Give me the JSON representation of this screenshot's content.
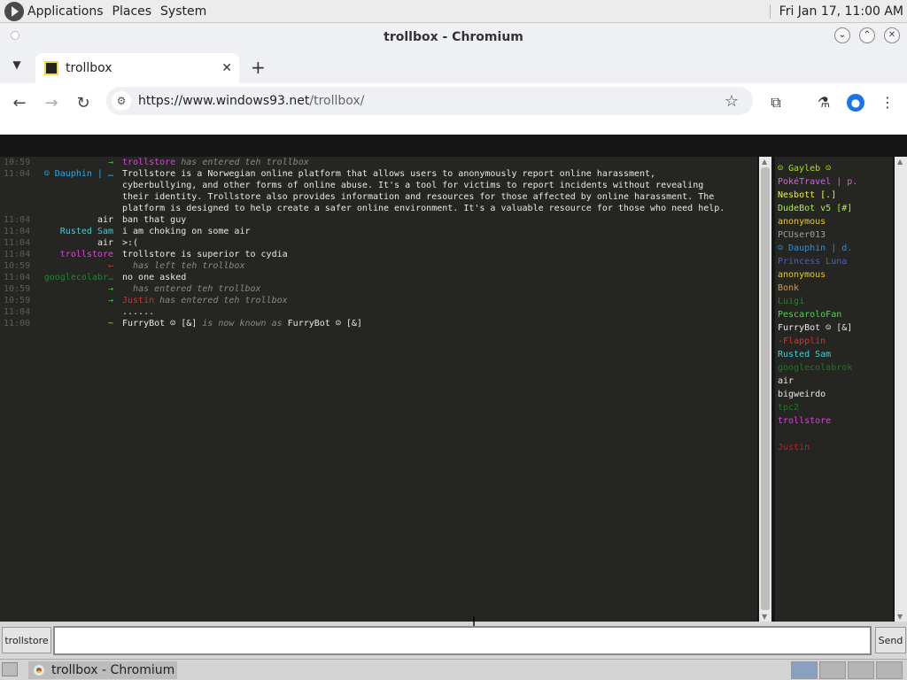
{
  "top_panel": {
    "menus": [
      "Applications",
      "Places",
      "System"
    ],
    "clock": "Fri Jan 17, 11:00 AM"
  },
  "window": {
    "title": "trollbox - Chromium",
    "tab_title": "trollbox",
    "url_host": "https://www.windows93.net",
    "url_path": "/trollbox/"
  },
  "chat": {
    "messages": [
      {
        "time": "10:59",
        "nick": "→",
        "nick_color": "#2ecc40",
        "body": "",
        "pre": "trollstore",
        "pre_color": "#e040e0",
        "sys": " has entered teh trollbox"
      },
      {
        "time": "11:04",
        "nick": "☺ Dauphin | …",
        "nick_color": "#2ea8e8",
        "body": "Trollstore is a Norwegian online platform that allows users to anonymously report online harassment, cyberbullying, and other forms of online abuse. It's a tool for victims to report incidents without revealing their identity. Trollstore also provides information and resources for those affected by online harassment. The platform is designed to help create a safer online environment. It's a valuable resource for those who need help."
      },
      {
        "time": "11:04",
        "nick": "air",
        "nick_color": "#e8e8e8",
        "body": "ban that guy"
      },
      {
        "time": "11:04",
        "nick": "Rusted Sam",
        "nick_color": "#40d0d8",
        "body": "i am choking on some air"
      },
      {
        "time": "11:04",
        "nick": "air",
        "nick_color": "#e8e8e8",
        "body": ">:("
      },
      {
        "time": "11:04",
        "nick": "trollstore",
        "nick_color": "#e040e0",
        "body": "trollstore is superior to cydia"
      },
      {
        "time": "10:59",
        "nick": "←",
        "nick_color": "#e03030",
        "body": "",
        "pre": "",
        "pre_color": "#e8e8e8",
        "sys": "  has left teh trollbox"
      },
      {
        "time": "11:04",
        "nick": "googlecolabr…",
        "nick_color": "#1f8a2a",
        "body": "no one asked"
      },
      {
        "time": "10:59",
        "nick": "→",
        "nick_color": "#2ecc40",
        "body": "",
        "pre": "",
        "pre_color": "#e8e8e8",
        "sys": "  has entered teh trollbox"
      },
      {
        "time": "10:59",
        "nick": "→",
        "nick_color": "#2ecc40",
        "body": "",
        "pre": "Justin",
        "pre_color": "#d03030",
        "sys": " has entered teh trollbox"
      },
      {
        "time": "11:04",
        "nick": "",
        "nick_color": "#e8e8e8",
        "body": "......"
      },
      {
        "time": "11:00",
        "nick": "~",
        "nick_color": "#e8c020",
        "body": "",
        "pre": "FurryBot ☺ [&]",
        "pre_color": "#e8e8e8",
        "sys": " is now known as ",
        "post": "FurryBot ☺ [&]"
      }
    ]
  },
  "users": [
    {
      "name": "☺ Gayleb ☺",
      "color": "#a8e020"
    },
    {
      "name": "PokéTravel | p.",
      "color": "#e060e0"
    },
    {
      "name": "Nesbott [.]",
      "color": "#f0f040"
    },
    {
      "name": "DudeBot v5 [#]",
      "color": "#a8f040"
    },
    {
      "name": "anonymous",
      "color": "#e8c830"
    },
    {
      "name": "PCUser013",
      "color": "#a0a0a0"
    },
    {
      "name": "☺ Dauphin | d.",
      "color": "#3090e0"
    },
    {
      "name": "Princess Luna",
      "color": "#4060e0"
    },
    {
      "name": "anonymous",
      "color": "#e8c830"
    },
    {
      "name": "Bonk",
      "color": "#f09030"
    },
    {
      "name": "Luigi",
      "color": "#2a8030"
    },
    {
      "name": "PescaroloFan",
      "color": "#40e040"
    },
    {
      "name": "FurryBot ☺ [&]",
      "color": "#e8e8e8"
    },
    {
      "name": "-Flapplin",
      "color": "#e03030"
    },
    {
      "name": "Rusted Sam",
      "color": "#40d0e0"
    },
    {
      "name": "googlecolabrok",
      "color": "#1a7a25"
    },
    {
      "name": "air",
      "color": "#e8e8e8"
    },
    {
      "name": "bigweirdo",
      "color": "#e8e8e8"
    },
    {
      "name": "tpc2",
      "color": "#1a7a25"
    },
    {
      "name": "trollstore",
      "color": "#e040e0"
    },
    {
      "name": "",
      "color": "#e8e8e8"
    },
    {
      "name": "Justin",
      "color": "#c02020"
    }
  ],
  "input": {
    "nick_label": "trollstore",
    "send_label": "Send",
    "value": ""
  },
  "taskbar": {
    "task_label": "trollbox - Chromium"
  }
}
